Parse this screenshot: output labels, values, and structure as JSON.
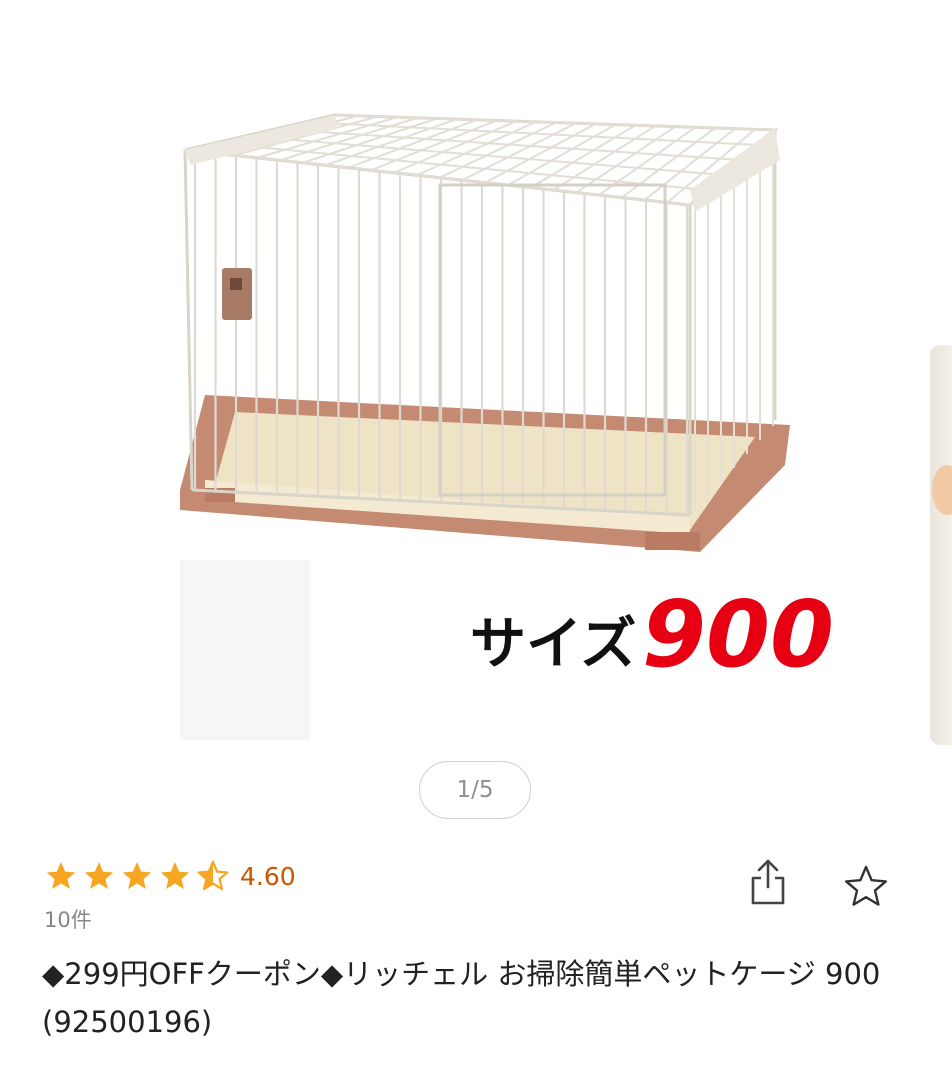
{
  "gallery": {
    "image_overlay_label": "サイズ",
    "image_overlay_value": "900",
    "counter": "1/5"
  },
  "product": {
    "rating": {
      "stars_value": 4.6,
      "stars_max": 5,
      "value_text": "4.60"
    },
    "review_count": "10件",
    "title": "◆299円OFFクーポン◆リッチェル お掃除簡単ペットケージ 900 (92500196)"
  },
  "actions": {
    "share_icon": "share-icon",
    "favorite_icon": "star-outline-icon"
  },
  "colors": {
    "star": "#f5a623",
    "rating_text": "#cc5500",
    "overlay_value": "#e60012"
  }
}
